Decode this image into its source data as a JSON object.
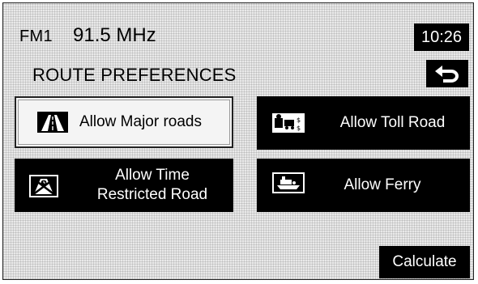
{
  "header": {
    "band": "FM1",
    "frequency": "91.5 MHz",
    "clock": "10:26"
  },
  "page": {
    "title": "ROUTE PREFERENCES",
    "back_icon": "back-arrow-icon"
  },
  "options": [
    {
      "label": "Allow Major roads",
      "icon": "major-road-icon",
      "selected": true
    },
    {
      "label": "Allow Toll Road",
      "icon": "toll-road-icon",
      "selected": false
    },
    {
      "label_line1": "Allow Time",
      "label_line2": "Restricted Road",
      "icon": "time-restricted-road-icon",
      "selected": false
    },
    {
      "label": "Allow Ferry",
      "icon": "ferry-icon",
      "selected": false
    }
  ],
  "actions": {
    "calculate_label": "Calculate"
  },
  "colors": {
    "button_bg": "#000000",
    "button_text": "#ffffff",
    "selected_bg": "#f4f4f4",
    "screen_bg": "#e9e9e9"
  }
}
